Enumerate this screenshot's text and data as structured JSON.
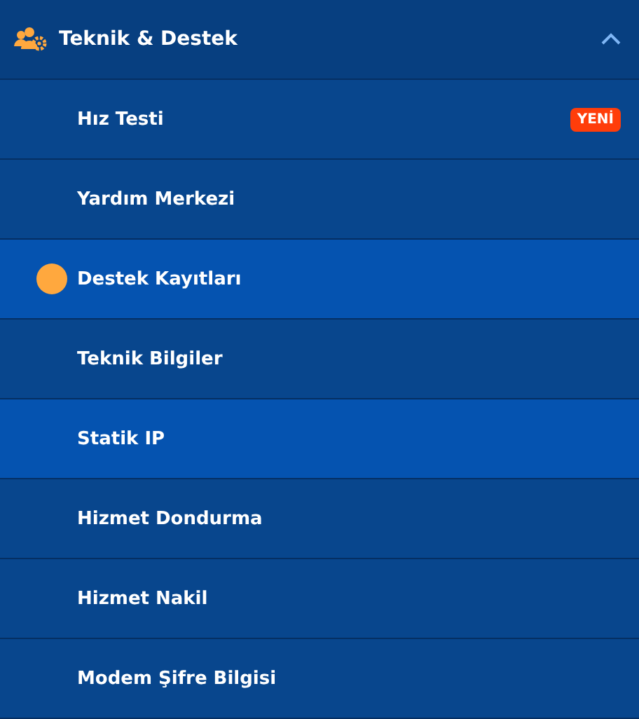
{
  "section": {
    "title": "Teknik & Destek",
    "expanded": true
  },
  "items": [
    {
      "label": "Hız Testi",
      "badge": "YENİ",
      "highlighted": false,
      "current": false
    },
    {
      "label": "Yardım Merkezi",
      "highlighted": false,
      "current": false
    },
    {
      "label": "Destek Kayıtları",
      "highlighted": true,
      "current": true
    },
    {
      "label": "Teknik Bilgiler",
      "highlighted": false,
      "current": false
    },
    {
      "label": "Statik IP",
      "highlighted": true,
      "current": false
    },
    {
      "label": "Hizmet Dondurma",
      "highlighted": false,
      "current": false
    },
    {
      "label": "Hizmet Nakil",
      "highlighted": false,
      "current": false
    },
    {
      "label": "Modem Şifre Bilgisi",
      "highlighted": false,
      "current": false
    }
  ]
}
